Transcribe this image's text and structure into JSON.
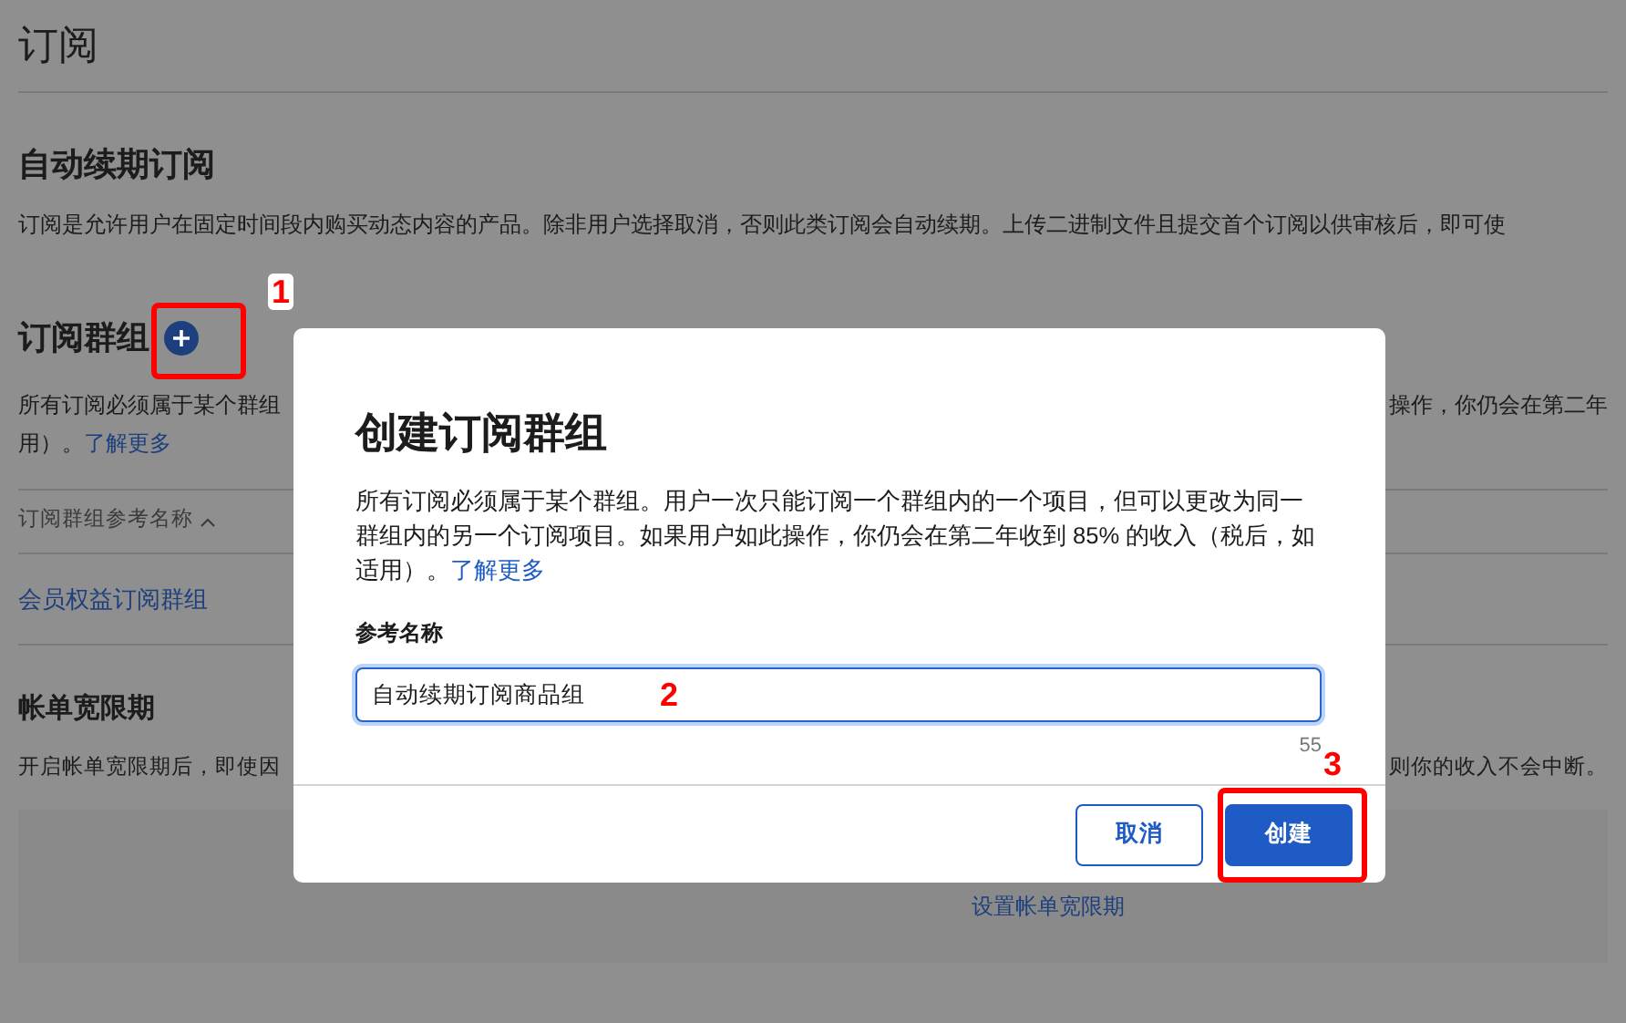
{
  "page": {
    "title": "订阅"
  },
  "auto_renew": {
    "heading": "自动续期订阅",
    "description": "订阅是允许用户在固定时间段内购买动态内容的产品。除非用户选择取消，否则此类订阅会自动续期。上传二进制文件且提交首个订阅以供审核后，即可使"
  },
  "groups": {
    "heading": "订阅群组",
    "description_left": "所有订阅必须属于某个群组",
    "description_right": "操作，你仍会在第二年",
    "description_line2": "用）。",
    "learn_more": "了解更多",
    "column_header": "订阅群组参考名称",
    "rows": [
      {
        "name": "会员权益订阅群组"
      }
    ]
  },
  "billing": {
    "heading": "帐单宽限期",
    "description_left": "开启帐单宽限期后，即使因",
    "description_right": "则你的收入不会中断。",
    "link": "设置帐单宽限期"
  },
  "dialog": {
    "title": "创建订阅群组",
    "description": "所有订阅必须属于某个群组。用户一次只能订阅一个群组内的一个项目，但可以更改为同一群组内的另一个订阅项目。如果用户如此操作，你仍会在第二年收到 85% 的收入（税后，如适用）。",
    "learn_more": "了解更多",
    "field_label": "参考名称",
    "field_value": "自动续期订阅商品组",
    "char_count": "55",
    "buttons": [
      {
        "label": "取消",
        "kind": "secondary"
      },
      {
        "label": "创建",
        "kind": "primary"
      }
    ]
  },
  "annotations": [
    "1",
    "2",
    "3"
  ]
}
